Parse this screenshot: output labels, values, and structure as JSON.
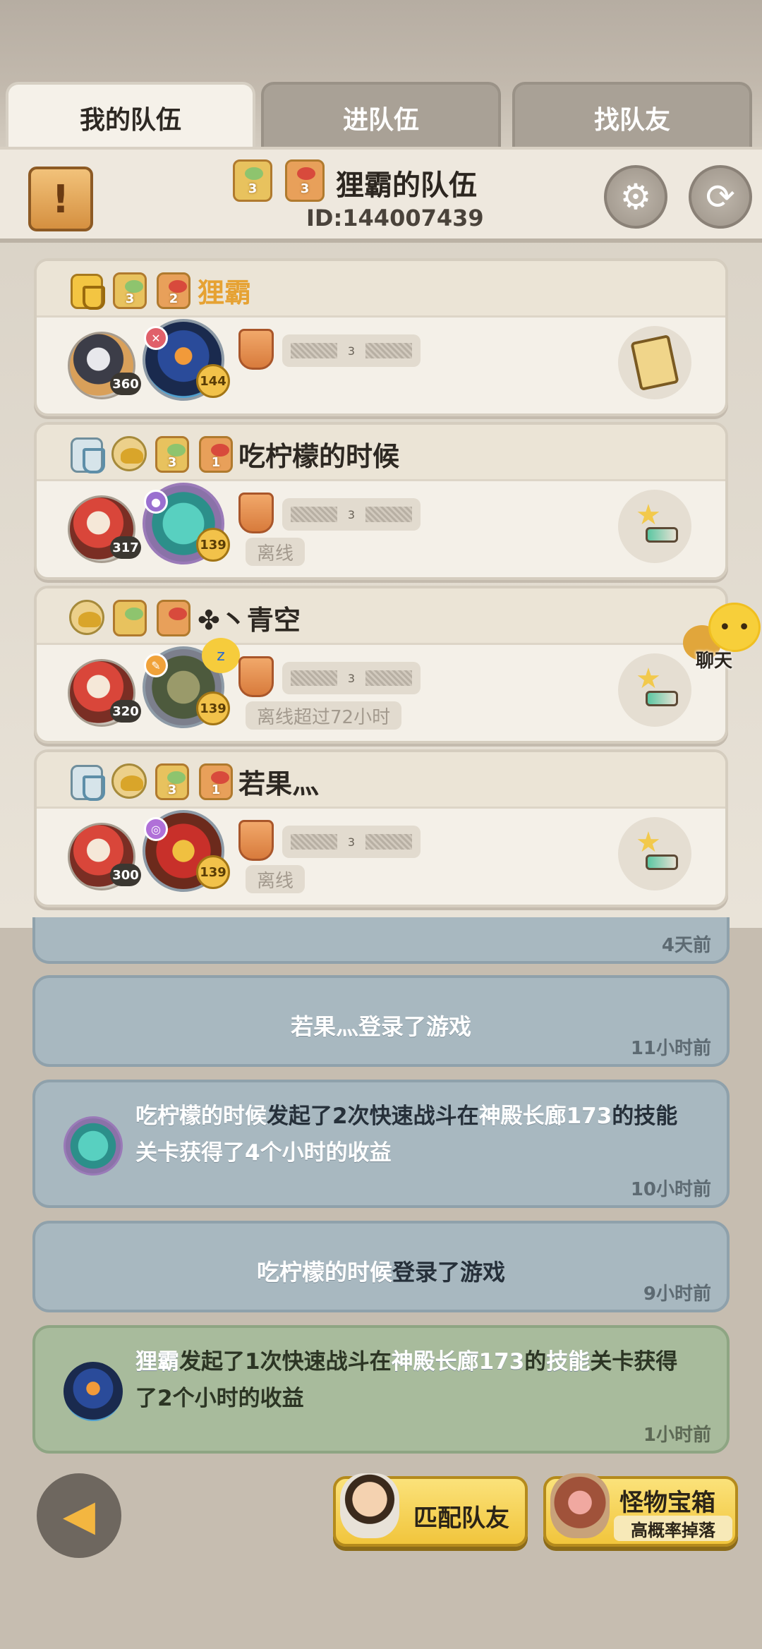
{
  "tabs": [
    {
      "label": "我的队伍",
      "active": true
    },
    {
      "label": "进队伍",
      "active": false
    },
    {
      "label": "找队友",
      "active": false
    }
  ],
  "team": {
    "name": "狸霸的队伍",
    "id": "ID:144007439",
    "badges": [
      "3",
      "3"
    ]
  },
  "members": [
    {
      "name": "狸霸",
      "badges": [
        "3",
        "2"
      ],
      "pet_level": "360",
      "hero_level": "144",
      "status": "",
      "leader": true
    },
    {
      "name": "吃柠檬的时候",
      "badges": [
        "3",
        "1"
      ],
      "pet_level": "317",
      "hero_level": "139",
      "status": "离线",
      "leader": false
    },
    {
      "name": "✤丶青空",
      "badges": [],
      "pet_level": "320",
      "hero_level": "139",
      "status": "离线超过72小时",
      "leader": false
    },
    {
      "name": "若果灬",
      "badges": [
        "3",
        "1"
      ],
      "pet_level": "300",
      "hero_level": "139",
      "status": "离线",
      "leader": false
    }
  ],
  "rank_center": "3",
  "chat": {
    "label": "聊天",
    "icon": "chat-bubble-icon"
  },
  "logs": [
    {
      "time": "4天前"
    },
    {
      "text": "若果灬登录了游戏",
      "time": "11小时前"
    },
    {
      "parts": [
        "吃柠檬的时候",
        "发起了2次快速战斗在",
        "神殿长廊173",
        "的技能",
        "关卡获得了4个小时的收益"
      ],
      "time": "10小时前"
    },
    {
      "parts": [
        "吃柠檬的时候",
        "登录了游戏"
      ],
      "time": "9小时前"
    },
    {
      "parts": [
        "狸霸",
        "发起了1次快速战斗在",
        "神殿长廊173",
        "的",
        "技能",
        "关卡获得了2个小时的收益"
      ],
      "time": "1小时前"
    }
  ],
  "buttons": {
    "match": "匹配队友",
    "chest": "怪物宝箱",
    "chest_sub": "高概率掉落"
  },
  "colors": {
    "leader_name": "#e6a233",
    "log_blue": "#a8b8c0",
    "log_green": "#a8bb9c",
    "button_yellow": "#f1c53c"
  }
}
